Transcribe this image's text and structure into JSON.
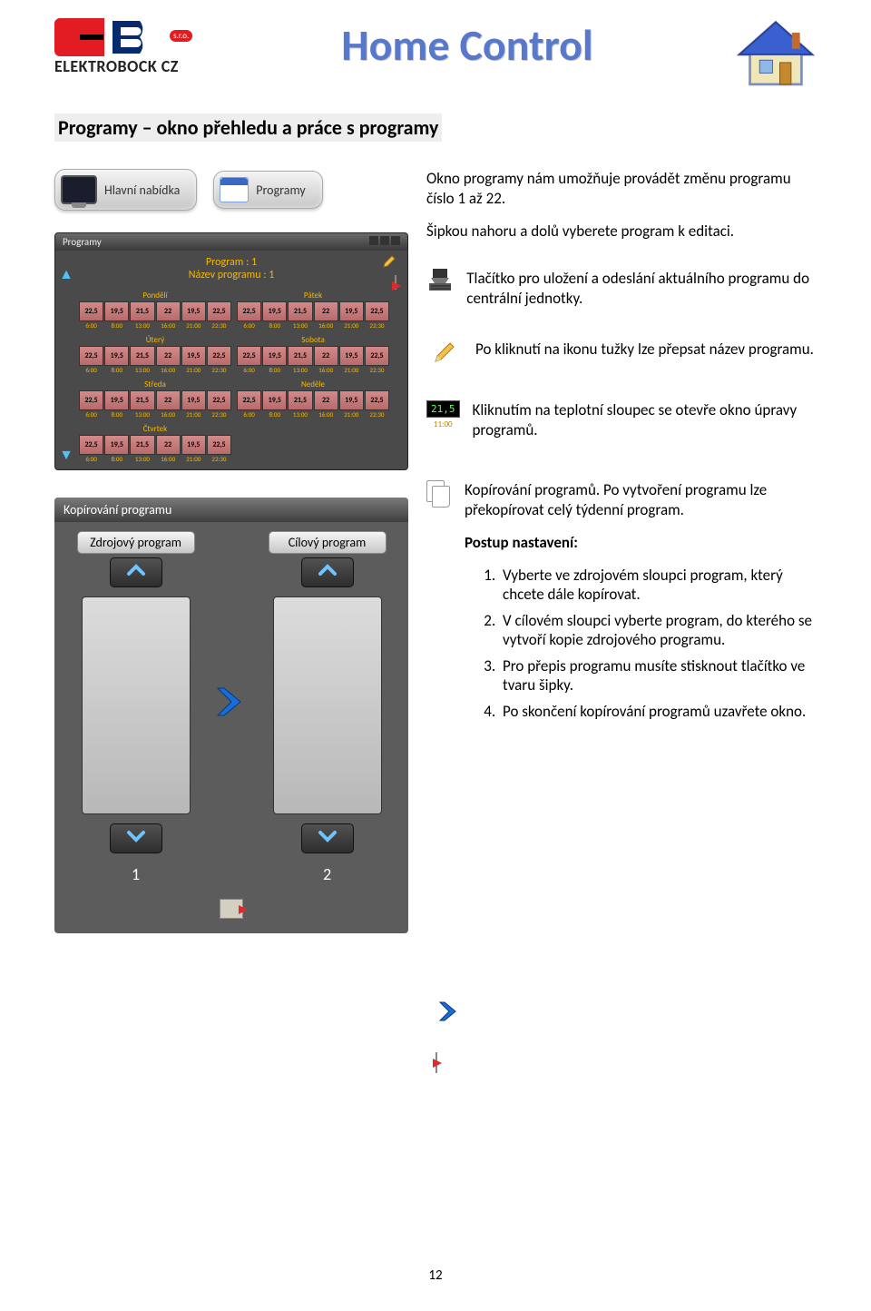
{
  "logo_text": "ELEKTROBOCK CZ",
  "logo_sro": "s.r.o.",
  "title": "Home Control",
  "section_title": "Programy – okno přehledu a práce s programy",
  "chip_main": "Hlavní nabídka",
  "chip_programy": "Programy",
  "app": {
    "titlebar": "Programy",
    "program_line1": "Program : 1",
    "program_line2": "Název programu : 1",
    "days": [
      "Pondělí",
      "Pátek",
      "Úterý",
      "Sobota",
      "Středa",
      "Neděle",
      "Čtvrtek"
    ],
    "temps": [
      "22,5",
      "19,5",
      "21,5",
      "22",
      "19,5",
      "22,5",
      "19,5",
      "21,5",
      "22",
      "19,5"
    ],
    "times": [
      "6:00",
      "8:00",
      "13:00",
      "16:00",
      "21:00",
      "22:30"
    ]
  },
  "intro_p1": "Okno programy nám umožňuje provádět změnu programu číslo 1 až 22.",
  "intro_p2": "Šipkou nahoru a dolů vyberete program k editaci.",
  "desc_save": "Tlačítko pro uložení a odeslání aktuálního programu do centrální jednotky.",
  "desc_pencil": "Po kliknutí na ikonu tužky lze přepsat název programu.",
  "desc_temp": "Kliknutím na teplotní sloupec se otevře okno úpravy programů.",
  "temp_value": "21,5",
  "temp_time": "11:00",
  "desc_copy": "Kopírování programů. Po vytvoření programu lze překopírovat celý týdenní program.",
  "procedure_title": "Postup nastavení:",
  "steps": [
    "Vyberte ve zdrojovém sloupci program, který chcete dále kopírovat.",
    "V cílovém sloupci vyberte program, do kterého se vytvoří kopie zdrojového programu.",
    "Pro přepis programu musíte stisknout tlačítko ve tvaru šipky.",
    "Po skončení kopírování programů uzavřete okno."
  ],
  "copy": {
    "title": "Kopírování programu",
    "source": "Zdrojový program",
    "target": "Cílový program",
    "num1": "1",
    "num2": "2"
  },
  "page_number": "12"
}
